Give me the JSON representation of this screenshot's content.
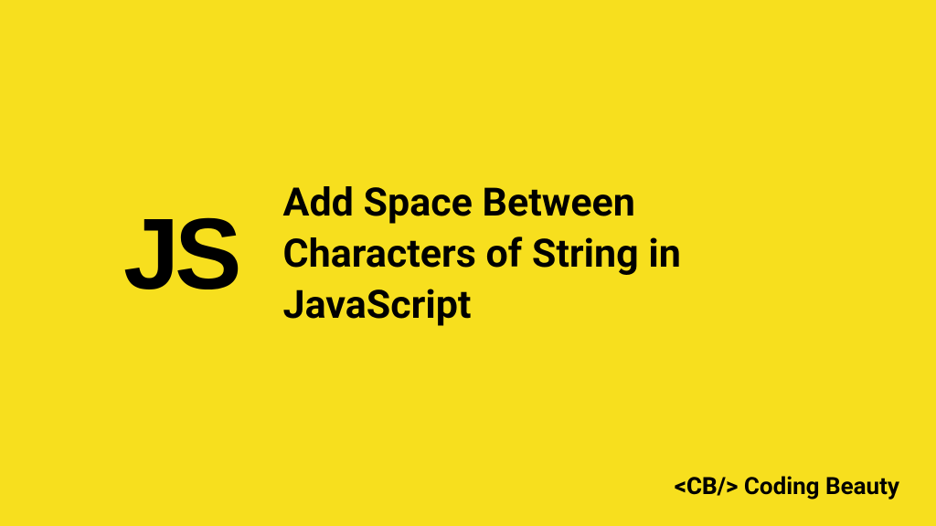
{
  "logo": "JS",
  "title": "Add Space Between Characters of String in JavaScript",
  "footer": {
    "tag": "<CB/>",
    "name": "Coding Beauty"
  }
}
